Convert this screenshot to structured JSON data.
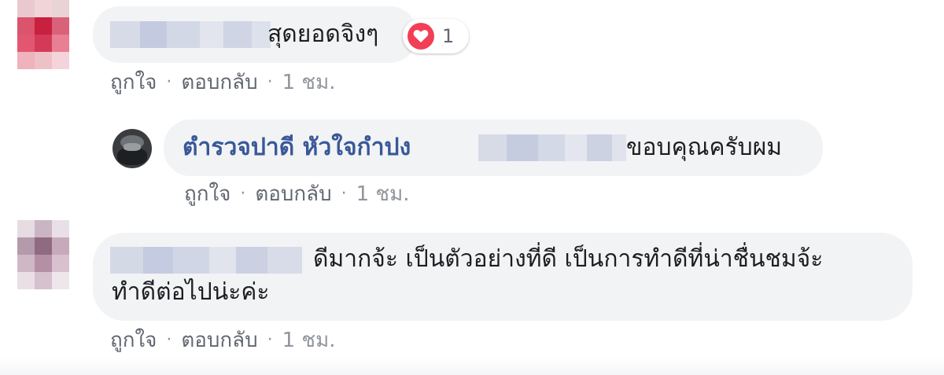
{
  "colors": {
    "bubble_bg": "#f2f3f5",
    "author_link": "#385898",
    "action_text": "#616770",
    "love_red": "#f33e58"
  },
  "comments": [
    {
      "author_blurred": true,
      "text": "สุดยอดจิงๆ",
      "reaction": {
        "icon": "heart-icon",
        "count": "1"
      },
      "actions": {
        "like": "ถูกใจ",
        "reply": "ตอบกลับ",
        "time": "1 ชม."
      }
    },
    {
      "is_reply": true,
      "author": "ตำรวจปาดี หัวใจกำปง",
      "mention_blurred": true,
      "text": "ขอบคุณครับผม",
      "actions": {
        "like": "ถูกใจ",
        "reply": "ตอบกลับ",
        "time": "1 ชม."
      }
    },
    {
      "author_blurred": true,
      "text_line1": "ดีมากจ้ะ เป็นตัวอย่างที่ดี เป็นการทำดีที่น่าชื่นชมจ้ะ",
      "text_line2": "ทำดีต่อไปน่ะค่ะ",
      "actions": {
        "like": "ถูกใจ",
        "reply": "ตอบกลับ",
        "time": "1 ชม."
      }
    }
  ],
  "separator": "·"
}
